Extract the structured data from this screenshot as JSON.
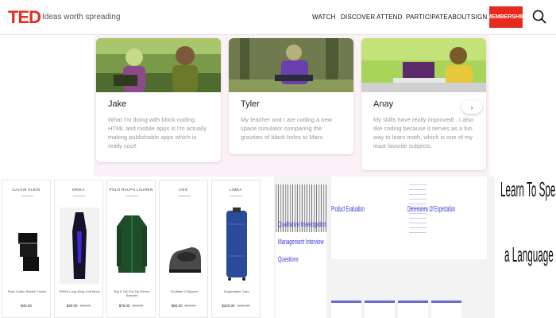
{
  "header": {
    "logo": "TED",
    "tagline": "Ideas worth spreading",
    "nav": [
      "WATCH",
      "DISCOVER",
      "ATTEND",
      "PARTICIPATE",
      "ABOUT"
    ],
    "sign_in": "SIGN IN",
    "membership": "MEMBERSHIP",
    "search_icon": "search-icon",
    "brand_color": "#e62b1e"
  },
  "stories": {
    "background": "#fbf1f7",
    "next_icon": "chevron-right-icon",
    "next_label": "›",
    "cards": [
      {
        "name": "Jake",
        "quote": "What I'm doing with block coding, HTML and mobile apps is I'm actually making publishable apps which is really cool!"
      },
      {
        "name": "Tyler",
        "quote": "My teacher and I are coding a new space simulator comparing the gravities of black holes to Mars."
      },
      {
        "name": "Anay",
        "quote": "My skills have really improved!...I also like coding because it serves as a fun way to learn math, which is one of my least favorite subjects."
      }
    ]
  },
  "products": [
    {
      "brand": "CALVIN KLEIN",
      "title": "Pack Cotton Stretch Trunks",
      "price": "$40.00",
      "old_price": ""
    },
    {
      "brand": "ERIKA",
      "title": "ERIKA Long Wrap Knit Mock",
      "price": "$30.00",
      "old_price": "$68.00"
    },
    {
      "brand": "POLO RALPH LAUREN",
      "title": "Big & Tall Full-Zip Fleece Sweater",
      "price": "$78.00",
      "old_price": "$98.00"
    },
    {
      "brand": "UGG",
      "title": "Scuffette II Slippers",
      "price": "$80.00",
      "old_price": "$98.00"
    },
    {
      "brand": "LIMEA",
      "title": "Expandable Case",
      "price": "$220.00",
      "old_price": "$388.00"
    }
  ],
  "slides": {
    "left_lines": [
      "Qualitative Investigation",
      "Management Interview",
      "Questions"
    ],
    "main_left": "Product Evaluation",
    "main_right": "Dimensions Of Expectation",
    "language_line1": "Learn To Speak",
    "language_line2": "a Language"
  }
}
